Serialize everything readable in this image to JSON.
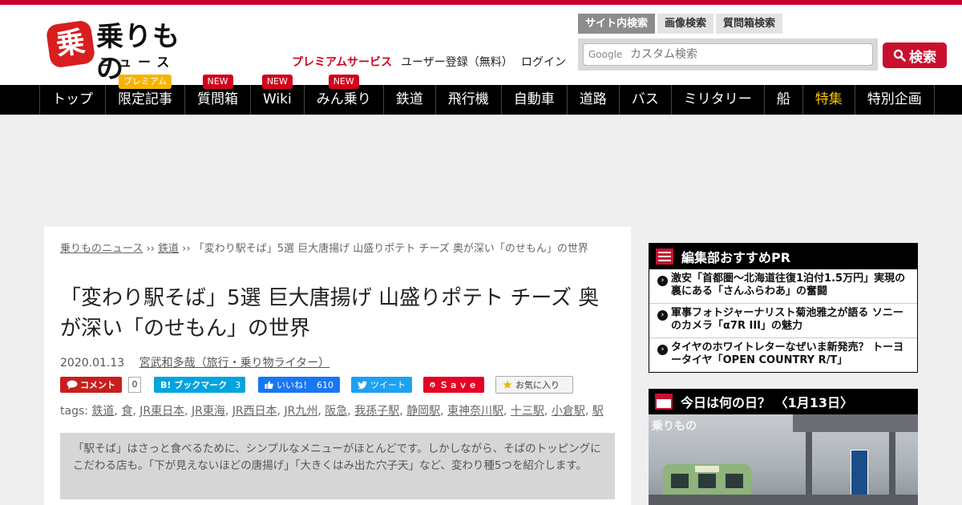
{
  "header": {
    "logo_top": "乗りもの",
    "logo_bottom": "ニュース",
    "logo_mark": "乗",
    "premium_link": "プレミアムサービス",
    "register_link": "ユーザー登録（無料）",
    "login_link": "ログイン"
  },
  "search": {
    "tabs": [
      "サイト内検索",
      "画像検索",
      "質問箱検索"
    ],
    "google_label": "Google",
    "placeholder": "カスタム検索",
    "button_label": "検索"
  },
  "nav": {
    "items": [
      {
        "label": "トップ"
      },
      {
        "label": "限定記事",
        "badge": "プレミアム"
      },
      {
        "label": "質問箱",
        "badge": "NEW"
      },
      {
        "label": "Wiki",
        "badge": "NEW"
      },
      {
        "label": "みん乗り",
        "badge": "NEW"
      },
      {
        "label": "鉄道"
      },
      {
        "label": "飛行機"
      },
      {
        "label": "自動車"
      },
      {
        "label": "道路"
      },
      {
        "label": "バス"
      },
      {
        "label": "ミリタリー"
      },
      {
        "label": "船"
      },
      {
        "label": "特集"
      },
      {
        "label": "特別企画"
      }
    ]
  },
  "article": {
    "breadcrumb": {
      "home": "乗りものニュース",
      "sep1": " ›› ",
      "category": "鉄道",
      "sep2": " ›› ",
      "current": "「変わり駅そば」5選 巨大唐揚げ 山盛りポテト チーズ 奥が深い「のせもん」の世界"
    },
    "title": "「変わり駅そば」5選 巨大唐揚げ 山盛りポテト チーズ 奥が深い「のせもん」の世界",
    "date": "2020.01.13",
    "author": "宮武和多哉（旅行・乗り物ライター）",
    "social": {
      "comment_label": "コメント",
      "comment_count": "0",
      "hatena_label": "B! ブックマーク",
      "hatena_count": "3",
      "fb_label": "いいね！",
      "fb_count": "610",
      "tweet_label": "ツイート",
      "pin_label": "Ｓａｖｅ",
      "fav_label": "お気に入り"
    },
    "tags_label": "tags: ",
    "tags": [
      "鉄道",
      "食",
      "JR東日本",
      "JR東海",
      "JR西日本",
      "JR九州",
      "阪急",
      "我孫子駅",
      "静岡駅",
      "東神奈川駅",
      "十三駅",
      "小倉駅",
      "駅"
    ],
    "lead": "「駅そば」はさっと食べるために、シンプルなメニューがほとんどです。しかしながら、そばのトッピングにこだわる店も。「下が見えないほどの唐揚げ」「大きくはみ出た穴子天」など、変わり種5つを紹介します。"
  },
  "sidebar": {
    "pr_title": "編集部おすすめPR",
    "pr_items": [
      "激安「首都圏～北海道往復1泊付1.5万円」実現の裏にある「さんふらわあ」の奮闘",
      "軍事フォトジャーナリスト菊池雅之が語る ソニーのカメラ「α7R III」の魅力",
      "タイヤのホワイトレターなぜいま新発売？ トーヨータイヤ「OPEN COUNTRY R/T」"
    ],
    "day_title": "今日は何の日？ 〈1月13日〉",
    "photo_logo": "乗りもの"
  },
  "colors": {
    "brand_red": "#c8102e",
    "nav_bg": "#000000",
    "highlight_yellow": "#f5c400"
  }
}
